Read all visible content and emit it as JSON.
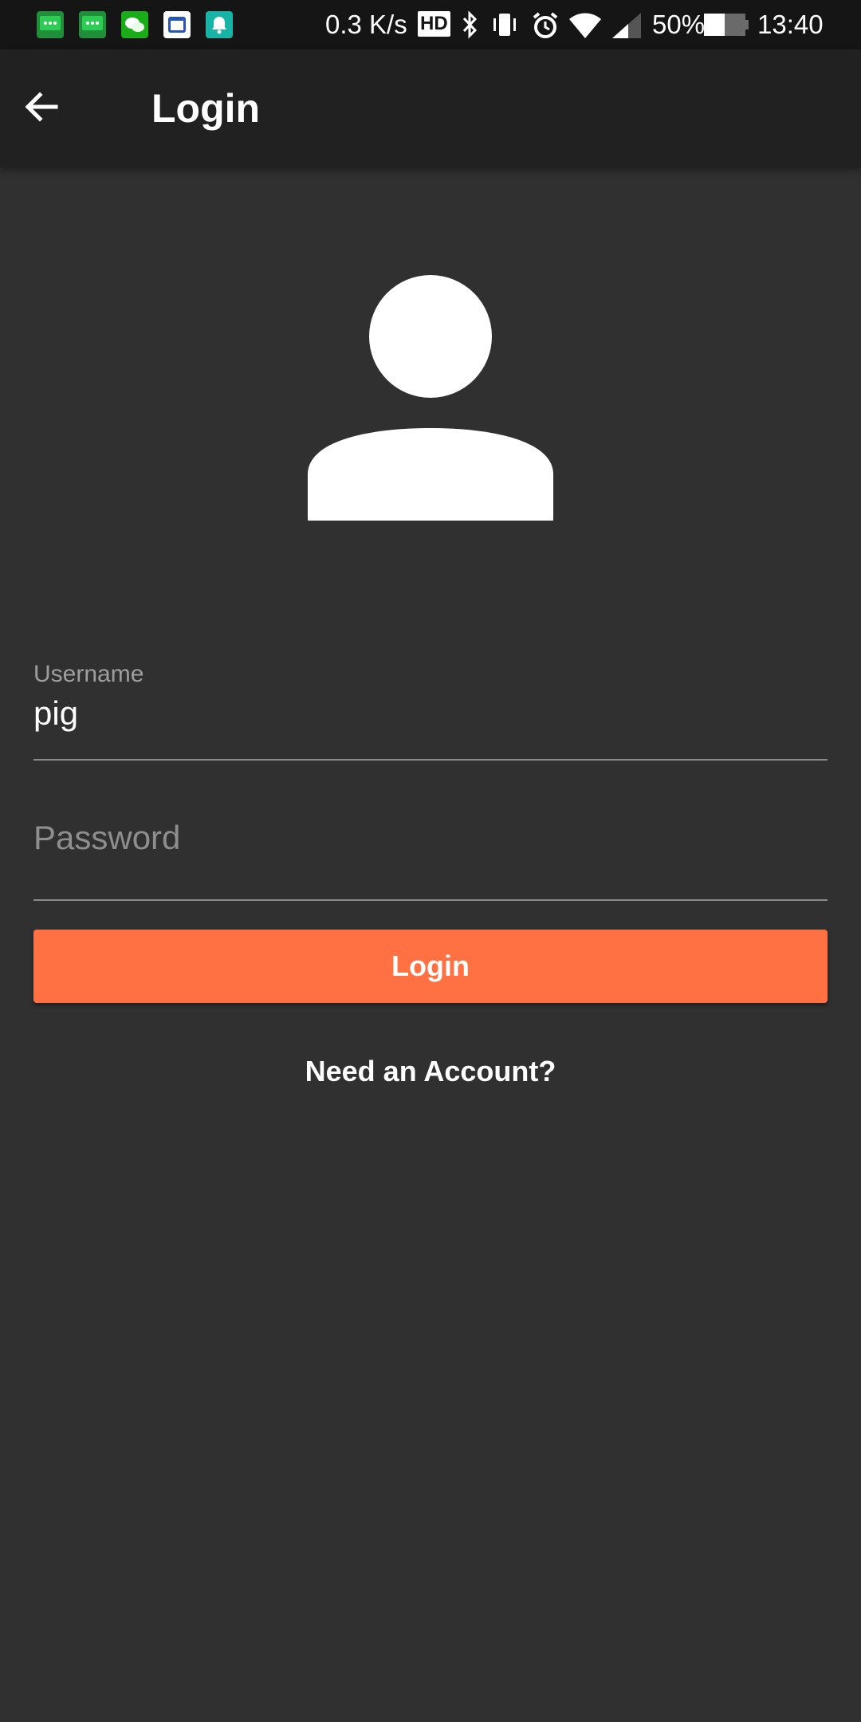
{
  "status_bar": {
    "network_speed": "0.3 K/s",
    "hd_badge": "HD",
    "battery_percent": "50%",
    "battery_level": 0.5,
    "time": "13:40",
    "notification_icons": [
      "sms-icon",
      "sms-icon",
      "wechat-icon",
      "calendar-app-icon",
      "notification-bell-icon"
    ],
    "system_icons": [
      "bluetooth-icon",
      "vibrate-icon",
      "alarm-icon",
      "wifi-icon",
      "signal-icon",
      "battery-icon"
    ]
  },
  "app_bar": {
    "back_icon": "arrow-back-icon",
    "title": "Login"
  },
  "avatar": {
    "icon": "person-icon"
  },
  "form": {
    "username": {
      "label": "Username",
      "value": "pig"
    },
    "password": {
      "placeholder": "Password",
      "value": ""
    },
    "login_button": {
      "label": "Login"
    },
    "account_link": {
      "label": "Need an Account?"
    }
  },
  "colors": {
    "background": "#303030",
    "app_bar": "#212121",
    "status_bar": "#151515",
    "accent": "#FF7043",
    "text": "#FFFFFF",
    "hint": "#8E8E8E"
  }
}
